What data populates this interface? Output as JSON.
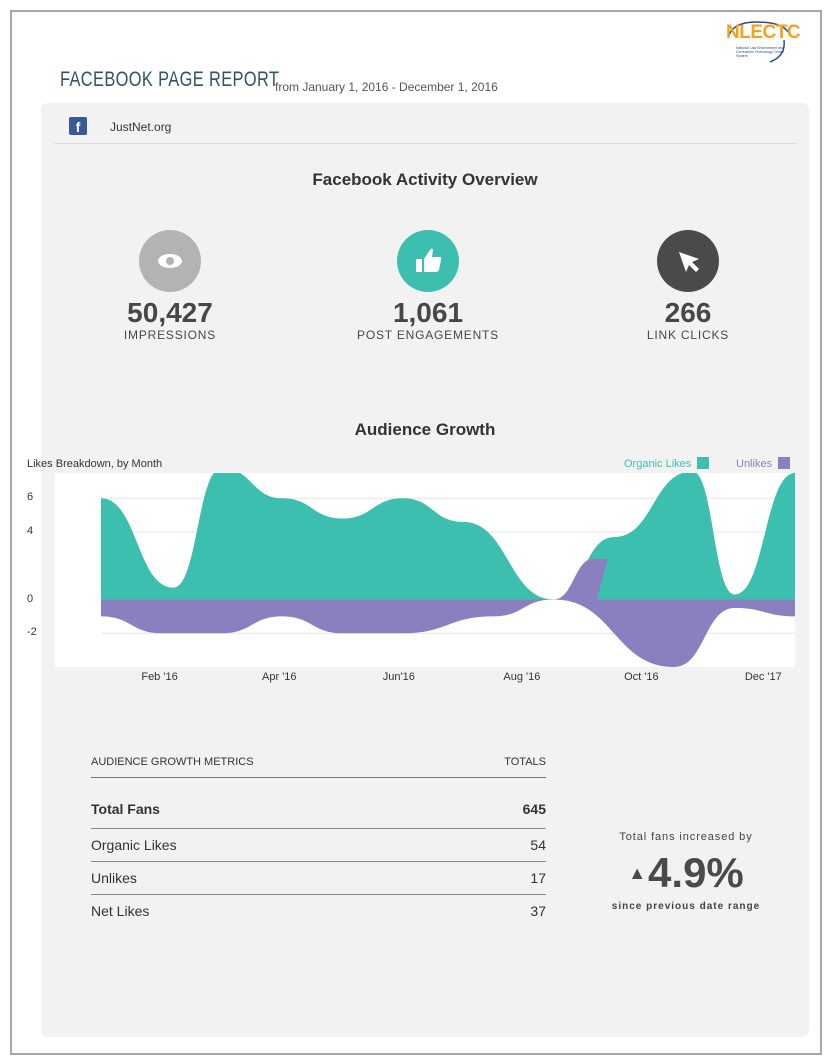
{
  "logo": {
    "text": "NLECTC",
    "subtitle": "National Law Enforcement and Corrections Technology Center System"
  },
  "report": {
    "title": "FACEBOOK PAGE REPORT",
    "date_range": "from January 1, 2016 - December 1, 2016"
  },
  "page": {
    "icon": "facebook-icon",
    "name": "JustNet.org"
  },
  "overview": {
    "title": "Facebook Activity Overview",
    "metrics": [
      {
        "icon": "eye-icon",
        "color": "#b3b3b3",
        "value": "50,427",
        "label": "IMPRESSIONS"
      },
      {
        "icon": "thumbs-up-icon",
        "color": "#3dbfb0",
        "value": "1,061",
        "label": "POST ENGAGEMENTS"
      },
      {
        "icon": "cursor-icon",
        "color": "#4a4a4a",
        "value": "266",
        "label": "LINK CLICKS"
      }
    ]
  },
  "growth_chart": {
    "title": "Audience Growth",
    "subtitle": "Likes Breakdown, by Month",
    "legend": [
      {
        "name": "Organic Likes",
        "color": "#3dbfb0"
      },
      {
        "name": "Unlikes",
        "color": "#8a80c0"
      }
    ]
  },
  "chart_data": {
    "type": "area",
    "title": "Audience Growth",
    "subtitle": "Likes Breakdown, by Month",
    "x_tick_labels": [
      "Feb '16",
      "Apr '16",
      "Jun'16",
      "Aug '16",
      "Oct '16",
      "Dec '17"
    ],
    "y_tick_labels": [
      "6",
      "4",
      "0",
      "-2"
    ],
    "ylim": [
      -4,
      7.5
    ],
    "grid": true,
    "legend_position": "top-right",
    "series": [
      {
        "name": "Organic Likes",
        "color": "#3dbfb0",
        "x": [
          0.0,
          1.2,
          2.0,
          3.0,
          4.0,
          5.0,
          6.0,
          7.5,
          8.5,
          9.8,
          10.5,
          11.5
        ],
        "values": [
          6,
          0.7,
          7.8,
          6,
          4.8,
          6,
          4.6,
          0,
          3.7,
          7.6,
          0.3,
          7.5
        ]
      },
      {
        "name": "Unlikes",
        "color": "#8a80c0",
        "x": [
          0.0,
          1.0,
          2.0,
          3.0,
          4.0,
          5.0,
          6.5,
          7.5,
          9.5,
          10.5,
          11.5
        ],
        "values": [
          -1,
          -2,
          -2,
          -1,
          -2,
          -2,
          -1,
          0,
          -4,
          -0.5,
          -1
        ],
        "positive_peak": {
          "x": 8.0,
          "value": 2.4
        }
      }
    ]
  },
  "metrics_table": {
    "header": {
      "metric": "AUDIENCE GROWTH METRICS",
      "total": "TOTALS"
    },
    "rows": [
      {
        "label": "Total Fans",
        "value": "645"
      },
      {
        "label": "Organic Likes",
        "value": "54"
      },
      {
        "label": "Unlikes",
        "value": "17"
      },
      {
        "label": "Net Likes",
        "value": "37"
      }
    ]
  },
  "growth_summary": {
    "text": "Total fans increased by",
    "value": "4.9%",
    "direction_icon": "triangle-up-icon",
    "caption": "since previous date range"
  }
}
